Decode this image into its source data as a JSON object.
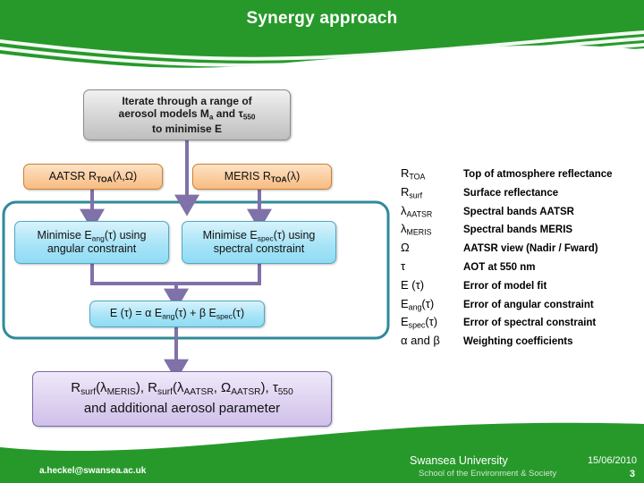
{
  "header": {
    "title": "Synergy approach",
    "band_color": "#27992b",
    "wave_color": "#ffffff"
  },
  "flow": {
    "iterate_box": {
      "line1": "Iterate through a range of",
      "line2_pre": "aerosol models M",
      "line2_sub1": "a",
      "line2_mid": " and ",
      "line2_tau": "τ",
      "line2_sub2": "550",
      "line3": "to minimise E"
    },
    "aatsr_box": {
      "pre": "AATSR R",
      "sub": "TOA",
      "post": "(λ,Ω)"
    },
    "meris_box": {
      "pre": "MERIS R",
      "sub": "TOA",
      "post": "(λ)"
    },
    "minimise_ang": {
      "pre": "Minimise E",
      "sub": "ang",
      "post": "(τ) using",
      "line2": "angular constraint"
    },
    "minimise_spec": {
      "pre": "Minimise E",
      "sub": "spec",
      "post": "(τ) using",
      "line2": "spectral constraint"
    },
    "equation": {
      "lhs": "E (τ) = α E",
      "sub1": "ang",
      "mid": "(τ) + β E",
      "sub2": "spec",
      "end": "(τ)"
    },
    "result_box": {
      "l1_a": "R",
      "l1_a_sub": "surf",
      "l1_b": "(λ",
      "l1_b_sub": "MERIS",
      "l1_c": "), R",
      "l1_c_sub": "surf",
      "l1_d": "(λ",
      "l1_d_sub": "AATSR",
      "l1_e": ", Ω",
      "l1_e_sub": "AATSR",
      "l1_f": "), τ",
      "l1_f_sub": "550",
      "line2": "and additional aerosol parameter"
    },
    "frame_color": "#2f8a99",
    "arrow_color": "#8071a8"
  },
  "legend": {
    "rows": [
      {
        "symbol": "R",
        "symbol_sub": "TOA",
        "desc": "Top of atmosphere reflectance"
      },
      {
        "symbol": "R",
        "symbol_sub": "surf",
        "desc": "Surface reflectance"
      },
      {
        "symbol": "λ",
        "symbol_sub": "AATSR",
        "desc": "Spectral bands AATSR"
      },
      {
        "symbol": "λ",
        "symbol_sub": "MERIS",
        "desc": "Spectral bands MERIS"
      },
      {
        "symbol": "Ω",
        "symbol_sub": "",
        "desc": "AATSR view (Nadir / Fward)"
      },
      {
        "symbol": "τ",
        "symbol_sub": "",
        "desc": "AOT at 550 nm"
      },
      {
        "symbol": "E (τ)",
        "symbol_sub": "",
        "desc": "Error of model fit"
      },
      {
        "symbol": "E",
        "symbol_sub": "ang",
        "symbol_post": "(τ)",
        "desc": "Error of angular constraint"
      },
      {
        "symbol": "E",
        "symbol_sub": "spec",
        "symbol_post": "(τ)",
        "desc": "Error of spectral constraint"
      },
      {
        "symbol": "α and β",
        "symbol_sub": "",
        "desc": "Weighting coefficients"
      }
    ]
  },
  "footer": {
    "email": "a.heckel@swansea.ac.uk",
    "university": "Swansea University",
    "school": "School of the Environment & Society",
    "date": "15/06/2010",
    "page": "3",
    "band_color": "#27992b"
  }
}
